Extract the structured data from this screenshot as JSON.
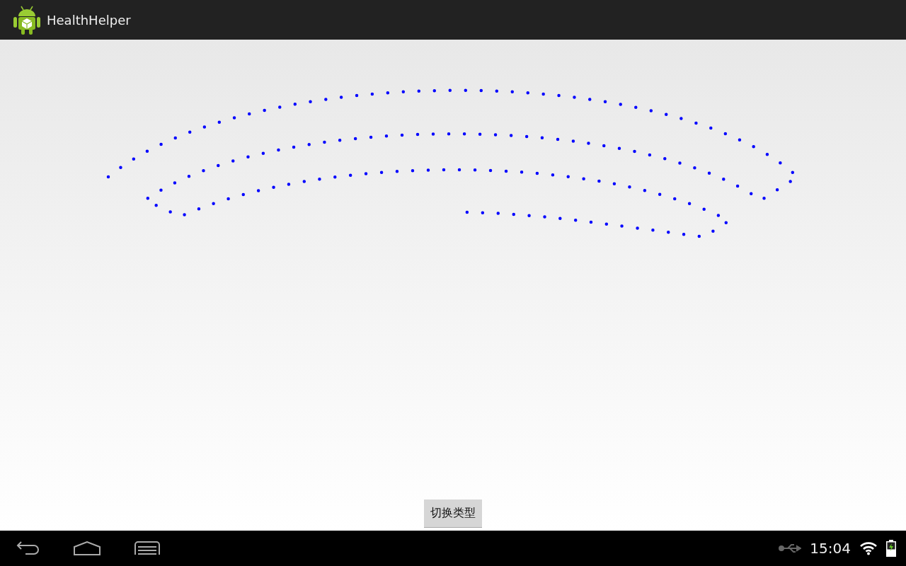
{
  "action_bar": {
    "title": "HealthHelper"
  },
  "content": {
    "button": "切换类型"
  },
  "status_bar": {
    "time": "15:04"
  }
}
